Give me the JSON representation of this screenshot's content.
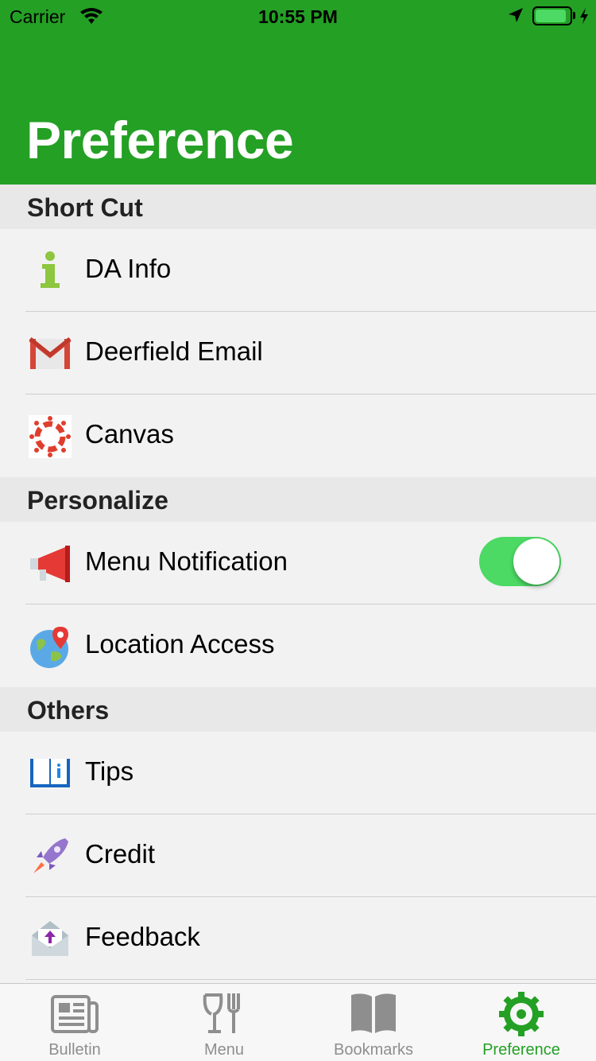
{
  "status_bar": {
    "carrier": "Carrier",
    "time": "10:55 PM"
  },
  "header": {
    "title": "Preference"
  },
  "sections": [
    {
      "title": "Short Cut",
      "items": [
        {
          "label": "DA Info",
          "icon": "info-icon"
        },
        {
          "label": "Deerfield Email",
          "icon": "gmail-icon"
        },
        {
          "label": "Canvas",
          "icon": "canvas-icon"
        }
      ]
    },
    {
      "title": "Personalize",
      "items": [
        {
          "label": "Menu Notification",
          "icon": "megaphone-icon",
          "toggle": true
        },
        {
          "label": "Location Access",
          "icon": "globe-pin-icon"
        }
      ]
    },
    {
      "title": "Others",
      "items": [
        {
          "label": "Tips",
          "icon": "book-info-icon"
        },
        {
          "label": "Credit",
          "icon": "rocket-icon"
        },
        {
          "label": "Feedback",
          "icon": "mail-upload-icon"
        }
      ]
    }
  ],
  "tabbar": {
    "tabs": [
      {
        "label": "Bulletin",
        "icon": "newspaper-icon",
        "active": false
      },
      {
        "label": "Menu",
        "icon": "dining-icon",
        "active": false
      },
      {
        "label": "Bookmarks",
        "icon": "book-icon",
        "active": false
      },
      {
        "label": "Preference",
        "icon": "gear-icon",
        "active": true
      }
    ]
  },
  "colors": {
    "header": "#24a025",
    "toggle_on": "#4cd964",
    "active_tab": "#24a025",
    "inactive_tab": "#8e8e8e"
  }
}
